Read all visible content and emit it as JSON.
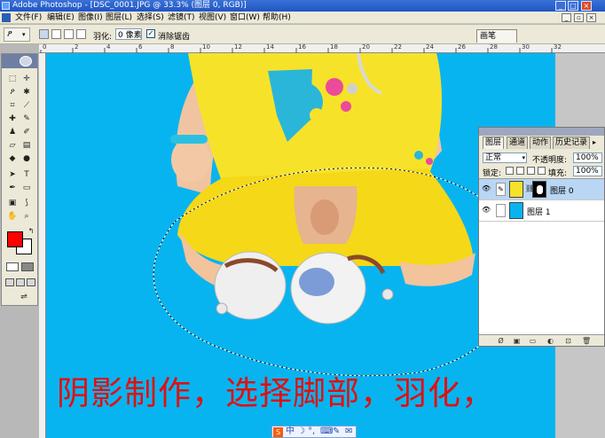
{
  "window": {
    "title": "Adobe Photoshop - [DSC_0001.JPG @ 33.3% (图层 0, RGB)]"
  },
  "menu": {
    "items": [
      "文件(F)",
      "编辑(E)",
      "图像(I)",
      "图层(L)",
      "选择(S)",
      "滤镜(T)",
      "视图(V)",
      "窗口(W)",
      "帮助(H)"
    ]
  },
  "options": {
    "feather_label": "羽化:",
    "feather_value": "0 像素",
    "antialias_label": "消除锯齿",
    "antialias_checked": true,
    "brushes_tab": "画笔"
  },
  "ruler": {
    "top_ticks": [
      "0",
      "2",
      "4",
      "6",
      "8",
      "10",
      "12",
      "14",
      "16",
      "18",
      "20",
      "22",
      "24",
      "26",
      "28",
      "30",
      "32"
    ]
  },
  "tools": {
    "foreground_color": "#ff0000",
    "background_color": "#ffffff"
  },
  "layers_panel": {
    "tabs": [
      "图层",
      "通道",
      "动作",
      "历史记录"
    ],
    "blend_mode": "正常",
    "opacity_label": "不透明度:",
    "opacity": "100%",
    "lock_label": "锁定:",
    "fill_label": "填充:",
    "fill": "100%",
    "layers": [
      {
        "name": "图层 0",
        "selected": true,
        "has_mask": true
      },
      {
        "name": "图层 1",
        "selected": false,
        "has_mask": false
      }
    ]
  },
  "canvas": {
    "background_color": "#08b4f0",
    "caption": "阴影制作，选择脚部，羽化，"
  },
  "ime": {
    "items": [
      "中",
      "☽",
      "°,",
      "⌨",
      "✎",
      "✉"
    ]
  }
}
